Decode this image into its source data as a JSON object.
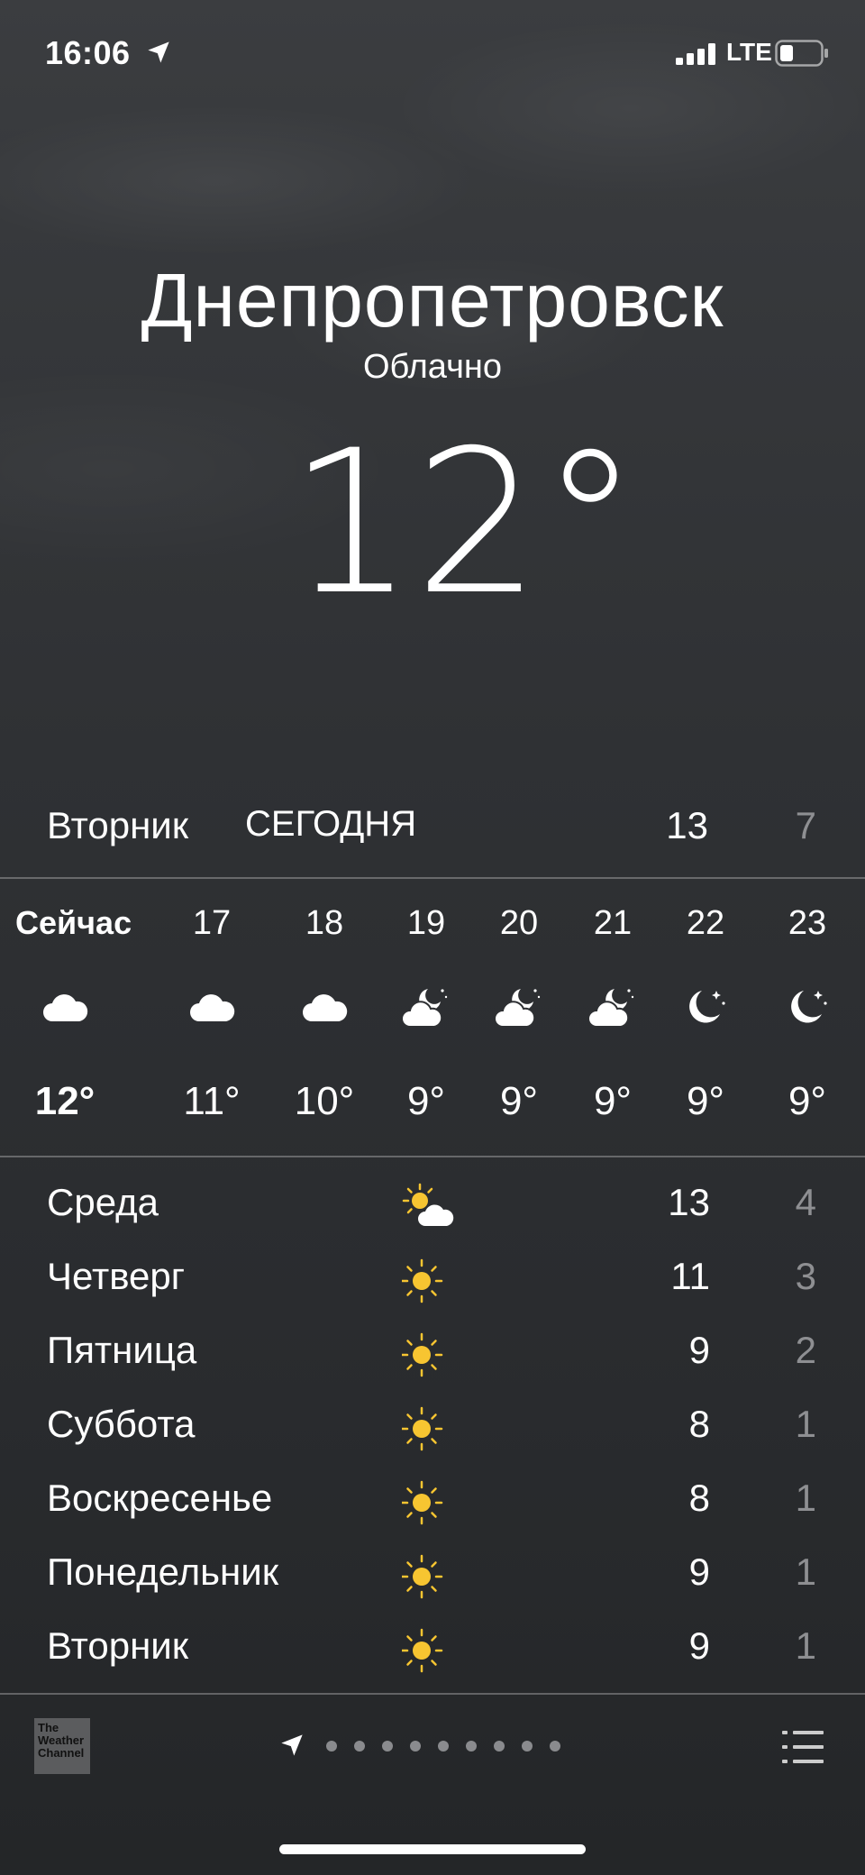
{
  "status_bar": {
    "time": "16:06",
    "network": "LTE",
    "icons": [
      "location-arrow-icon",
      "signal-icon",
      "battery-icon"
    ]
  },
  "location": {
    "city": "Днепропетровск",
    "condition": "Облачно",
    "temperature": "12°"
  },
  "today": {
    "day": "Вторник",
    "tag": "СЕГОДНЯ",
    "high": "13",
    "low": "7"
  },
  "hourly": [
    {
      "hour": "Сейчас",
      "icon": "cloud",
      "temp": "12°"
    },
    {
      "hour": "17",
      "icon": "cloud",
      "temp": "11°"
    },
    {
      "hour": "18",
      "icon": "cloud",
      "temp": "10°"
    },
    {
      "hour": "19",
      "icon": "cloud-moon",
      "temp": "9°"
    },
    {
      "hour": "20",
      "icon": "cloud-moon",
      "temp": "9°"
    },
    {
      "hour": "21",
      "icon": "cloud-moon",
      "temp": "9°"
    },
    {
      "hour": "22",
      "icon": "moon-stars",
      "temp": "9°"
    },
    {
      "hour": "23",
      "icon": "moon-stars",
      "temp": "9°"
    }
  ],
  "daily": [
    {
      "day": "Среда",
      "icon": "sun-cloud",
      "high": "13",
      "low": "4"
    },
    {
      "day": "Четверг",
      "icon": "sun",
      "high": "11",
      "low": "3"
    },
    {
      "day": "Пятница",
      "icon": "sun",
      "high": "9",
      "low": "2"
    },
    {
      "day": "Суббота",
      "icon": "sun",
      "high": "8",
      "low": "1"
    },
    {
      "day": "Воскресенье",
      "icon": "sun",
      "high": "8",
      "low": "1"
    },
    {
      "day": "Понедельник",
      "icon": "sun",
      "high": "9",
      "low": "1"
    },
    {
      "day": "Вторник",
      "icon": "sun",
      "high": "9",
      "low": "1"
    }
  ],
  "footer": {
    "brand": "The Weather Channel",
    "page_count": 10,
    "current_page": 0
  }
}
